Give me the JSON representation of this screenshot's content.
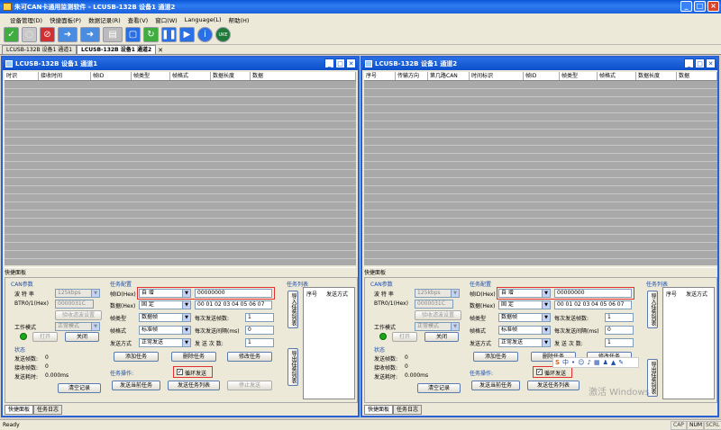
{
  "app_title": "朱可CAN卡通用监测软件 - LCUSB-132B 设备1 通道2",
  "menu": [
    "设备管理(D)",
    "快捷面板(P)",
    "数据记录(R)",
    "查看(V)",
    "窗口(W)",
    "Language(L)",
    "帮助(H)"
  ],
  "tabs": [
    "LCUSB-132B 设备1 通道1",
    "LCUSB-132B 设备1 通道2"
  ],
  "win1": {
    "title": "LCUSB-132B 设备1 通道1",
    "cols": [
      "时识",
      "接收时间",
      "帧ID",
      "帧类型",
      "帧格式",
      "数据长度",
      "数据"
    ]
  },
  "win2": {
    "title": "LCUSB-132B 设备1 通道2",
    "cols": [
      "序号",
      "传输方向",
      "第几路CAN",
      "时间标识",
      "帧ID",
      "帧类型",
      "帧格式",
      "数据长度",
      "数据"
    ]
  },
  "panel": {
    "title": "快捷面板",
    "can_params": "CAN参数",
    "baud_label": "波 特 率",
    "baud_value": "125kbps",
    "btr_label": "BTR0/1(Hex)",
    "btr_value": "0000031C",
    "verify_btn": "验收滤波设置",
    "mode_label": "工作模式",
    "mode_value": "正常模式",
    "open_btn": "打开",
    "close_btn": "关闭",
    "status_title": "状态",
    "sent_label": "发送帧数:",
    "sent_value": "0",
    "recv_label": "接收帧数:",
    "recv_value": "0",
    "time_label": "发送耗时:",
    "time_value": "0.000ms",
    "clear_btn": "清空记录",
    "task_config": "任务配置",
    "frameid_label": "帧ID(Hex)",
    "frameid_mode": "自 增",
    "frameid_value": "00000000",
    "data_label": "数据(Hex)",
    "data_mode": "固 定",
    "data_value": "00 01 02 03 04 05 06 07",
    "ftype_label": "帧类型",
    "ftype_value": "数据帧",
    "fcount_label": "每次发送帧数:",
    "fcount_value": "1",
    "fformat_label": "帧格式",
    "fformat_value": "标准帧",
    "interval_label": "每次发送间隔(ms)",
    "interval_value": "0",
    "sendmode_label": "发送方式",
    "sendmode_value": "正常发送",
    "sendtimes_label": "发 送 次 数:",
    "sendtimes_value": "1",
    "add_btn": "添加任务",
    "del_btn": "删除任务",
    "mod_btn": "修改任务",
    "task_ops": "任务操作:",
    "loop_label": "循环发送",
    "send_cur_btn": "发送当前任务",
    "send_list_btn": "发送任务列表",
    "stop_btn": "停止发送",
    "task_list": "任务列表",
    "list_cols": [
      "序号",
      "发送方式"
    ],
    "import_btn": "导入任务列表",
    "export_btn": "导出任务列表"
  },
  "bottom_tabs": [
    "快捷面板",
    "任务日志"
  ],
  "status": {
    "left": "Ready",
    "caps": "CAP",
    "num": "NUM",
    "scrl": "SCRL"
  },
  "watermark": "激活 Windows"
}
